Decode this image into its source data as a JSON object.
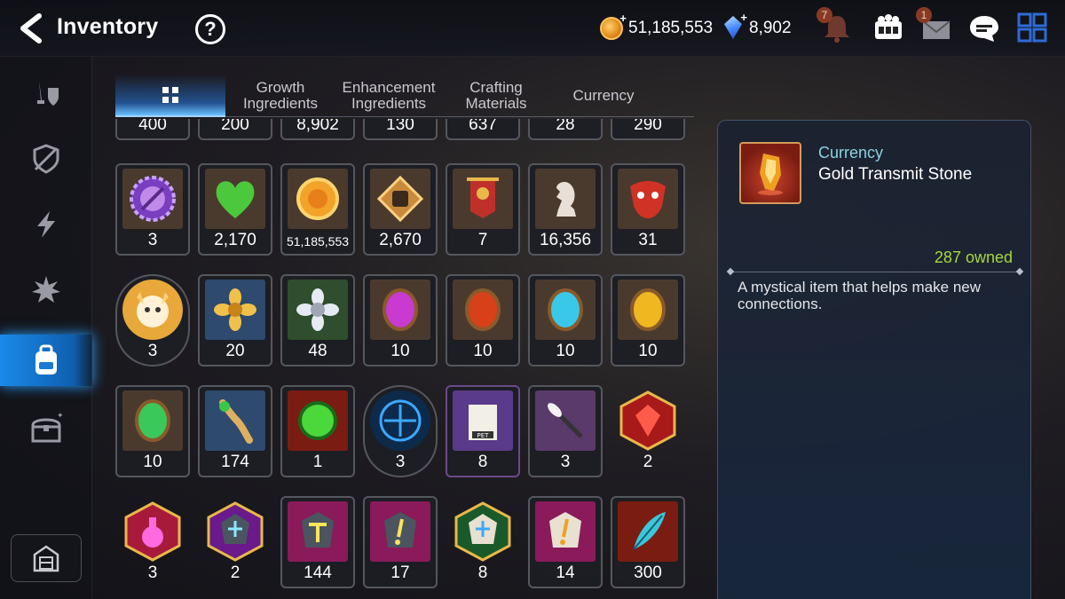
{
  "header": {
    "title": "Inventory",
    "help_label": "?",
    "gold": "51,185,553",
    "skystone": "8,902",
    "notification_badge": "7",
    "mail_badge": "1"
  },
  "sidebar": {
    "items": [
      {
        "name": "equipment-icon"
      },
      {
        "name": "artifact-icon"
      },
      {
        "name": "catalyst-icon"
      },
      {
        "name": "material-icon"
      },
      {
        "name": "inventory-bag-icon",
        "active": true
      },
      {
        "name": "chest-icon"
      }
    ],
    "bottom": "storage-icon"
  },
  "tabs": [
    {
      "label": "",
      "icon": "grid-icon",
      "active": true
    },
    {
      "label": "Growth\nIngredients"
    },
    {
      "label": "Enhancement\nIngredients"
    },
    {
      "label": "Crafting\nMaterials"
    },
    {
      "label": "Currency"
    }
  ],
  "grid": {
    "row0": [
      "400",
      "200",
      "8,902",
      "130",
      "637",
      "28",
      "290"
    ],
    "row1": [
      "3",
      "2,170",
      "51,185,553",
      "2,670",
      "7",
      "16,356",
      "31"
    ],
    "row2": [
      "3",
      "20",
      "48",
      "10",
      "10",
      "10",
      "10"
    ],
    "row3": [
      "10",
      "174",
      "1",
      "3",
      "8",
      "3",
      "2"
    ],
    "row4": [
      "3",
      "2",
      "144",
      "17",
      "8",
      "14",
      "300"
    ]
  },
  "detail": {
    "category": "Currency",
    "name": "Gold Transmit Stone",
    "owned": "287 owned",
    "description": "A mystical item that helps make new connections."
  },
  "colors": {
    "accent_blue": "#1a8ae8",
    "owned_green": "#a6d83c",
    "category_cyan": "#8cd2e0"
  }
}
